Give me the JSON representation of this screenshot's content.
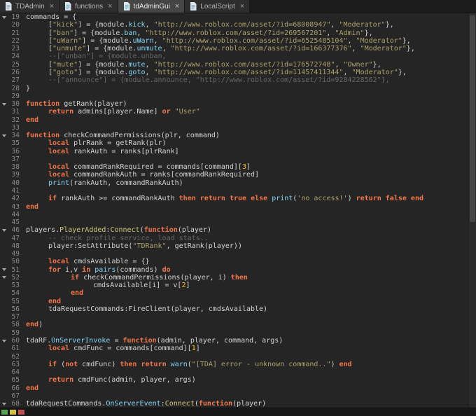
{
  "tabs": [
    {
      "label": "TDAdmin",
      "active": false,
      "icon_color": "#8AA9C4"
    },
    {
      "label": "functions",
      "active": false,
      "icon_color": "#56B8CF"
    },
    {
      "label": "tdAdminGui",
      "active": true,
      "icon_color": "#56B8CF"
    },
    {
      "label": "LocalScript",
      "active": false,
      "icon_color": "#6FA8DC"
    }
  ],
  "tab_close_glyph": "×",
  "colors": {
    "editor_bg": "#252525",
    "tabbar_bg": "#1b1b1b",
    "tab_bg": "#2d2d2d",
    "tab_active_bg": "#454545",
    "plain": "#D4D4D4",
    "keyword": "#F2764A",
    "string": "#ADA16D",
    "comment": "#676767",
    "number": "#FFC600",
    "builtin": "#84D6F7",
    "member": "#84D6F7",
    "method": "#CFC878",
    "line_number": "#8A8A8A"
  },
  "editor": {
    "language": "lua",
    "first_line": 19,
    "last_line": 68,
    "lines": [
      {
        "n": 19,
        "fold": true,
        "i": 0,
        "t": [
          [
            "p",
            "commands = {"
          ]
        ]
      },
      {
        "n": 20,
        "i": 1,
        "t": [
          [
            "p",
            "["
          ],
          [
            "s",
            "\"kick\""
          ],
          [
            "p",
            "] = {module."
          ],
          [
            "m",
            "kick"
          ],
          [
            "p",
            ", "
          ],
          [
            "s",
            "\"http://www.roblox.com/asset/?id=68008947\""
          ],
          [
            "p",
            ", "
          ],
          [
            "s",
            "\"Moderator\""
          ],
          [
            "p",
            "},"
          ]
        ]
      },
      {
        "n": 21,
        "i": 1,
        "t": [
          [
            "p",
            "["
          ],
          [
            "s",
            "\"ban\""
          ],
          [
            "p",
            "] = {module."
          ],
          [
            "m",
            "ban"
          ],
          [
            "p",
            ", "
          ],
          [
            "s",
            "\"http://www.roblox.com/asset/?id=269567201\""
          ],
          [
            "p",
            ", "
          ],
          [
            "s",
            "\"Admin\""
          ],
          [
            "p",
            "},"
          ]
        ]
      },
      {
        "n": 22,
        "i": 1,
        "t": [
          [
            "p",
            "["
          ],
          [
            "s",
            "\"uWarn\""
          ],
          [
            "p",
            "] = {module."
          ],
          [
            "m",
            "uWarn"
          ],
          [
            "p",
            ", "
          ],
          [
            "s",
            "\"http://www.roblox.com/asset/?id=6525485104\""
          ],
          [
            "p",
            ", "
          ],
          [
            "s",
            "\"Moderator\""
          ],
          [
            "p",
            "},"
          ]
        ]
      },
      {
        "n": 23,
        "i": 1,
        "t": [
          [
            "p",
            "["
          ],
          [
            "s",
            "\"unmute\""
          ],
          [
            "p",
            "] = {module."
          ],
          [
            "m",
            "unmute"
          ],
          [
            "p",
            ", "
          ],
          [
            "s",
            "\"http://www.roblox.com/asset/?id=166377376\""
          ],
          [
            "p",
            ", "
          ],
          [
            "s",
            "\"Moderator\""
          ],
          [
            "p",
            "},"
          ]
        ]
      },
      {
        "n": 24,
        "i": 1,
        "t": [
          [
            "c",
            "--[\"unban\"] = {module.unban,"
          ]
        ]
      },
      {
        "n": 25,
        "i": 1,
        "t": [
          [
            "p",
            "["
          ],
          [
            "s",
            "\"mute\""
          ],
          [
            "p",
            "] = {module."
          ],
          [
            "m",
            "mute"
          ],
          [
            "p",
            ", "
          ],
          [
            "s",
            "\"http://www.roblox.com/asset/?id=176572748\""
          ],
          [
            "p",
            ", "
          ],
          [
            "s",
            "\"Owner\""
          ],
          [
            "p",
            "},"
          ]
        ]
      },
      {
        "n": 26,
        "i": 1,
        "t": [
          [
            "p",
            "["
          ],
          [
            "s",
            "\"goto\""
          ],
          [
            "p",
            "] = {module."
          ],
          [
            "m",
            "goto"
          ],
          [
            "p",
            ", "
          ],
          [
            "s",
            "\"http://www.roblox.com/asset/?id=11457411344\""
          ],
          [
            "p",
            ", "
          ],
          [
            "s",
            "\"Moderator\""
          ],
          [
            "p",
            "},"
          ]
        ]
      },
      {
        "n": 27,
        "i": 1,
        "t": [
          [
            "c",
            "--[\"announce\"] = {module.announce, \"http://www.roblox.com/asset/?id=9284228562\"},"
          ]
        ]
      },
      {
        "n": 28,
        "i": 0,
        "t": [
          [
            "p",
            "}"
          ]
        ]
      },
      {
        "n": 29,
        "i": 0,
        "t": []
      },
      {
        "n": 30,
        "fold": true,
        "i": 0,
        "t": [
          [
            "k",
            "function"
          ],
          [
            "p",
            " getRank(player)"
          ]
        ]
      },
      {
        "n": 31,
        "i": 1,
        "t": [
          [
            "k",
            "return"
          ],
          [
            "p",
            " admins[player.Name] "
          ],
          [
            "k",
            "or"
          ],
          [
            "p",
            " "
          ],
          [
            "s",
            "\"User\""
          ]
        ]
      },
      {
        "n": 32,
        "i": 0,
        "t": [
          [
            "k",
            "end"
          ]
        ]
      },
      {
        "n": 33,
        "i": 0,
        "t": []
      },
      {
        "n": 34,
        "fold": true,
        "i": 0,
        "t": [
          [
            "k",
            "function"
          ],
          [
            "p",
            " checkCommandPermissions(plr, command)"
          ]
        ]
      },
      {
        "n": 35,
        "i": 1,
        "t": [
          [
            "k",
            "local"
          ],
          [
            "p",
            " plrRank = getRank(plr)"
          ]
        ]
      },
      {
        "n": 36,
        "i": 1,
        "t": [
          [
            "k",
            "local"
          ],
          [
            "p",
            " rankAuth = ranks[plrRank]"
          ]
        ]
      },
      {
        "n": 37,
        "i": 0,
        "t": []
      },
      {
        "n": 38,
        "i": 1,
        "t": [
          [
            "k",
            "local"
          ],
          [
            "p",
            " commandRankRequired = commands[command]["
          ],
          [
            "n",
            "3"
          ],
          [
            "p",
            "]"
          ]
        ]
      },
      {
        "n": 39,
        "i": 1,
        "t": [
          [
            "k",
            "local"
          ],
          [
            "p",
            " commandRankAuth = ranks[commandRankRequired]"
          ]
        ]
      },
      {
        "n": 40,
        "i": 1,
        "t": [
          [
            "b",
            "print"
          ],
          [
            "p",
            "(rankAuth, commandRankAuth)"
          ]
        ]
      },
      {
        "n": 41,
        "i": 0,
        "t": []
      },
      {
        "n": 42,
        "i": 1,
        "t": [
          [
            "k",
            "if"
          ],
          [
            "p",
            " rankAuth >= commandRankAuth "
          ],
          [
            "k",
            "then"
          ],
          [
            "p",
            " "
          ],
          [
            "k",
            "return"
          ],
          [
            "p",
            " "
          ],
          [
            "k",
            "true"
          ],
          [
            "p",
            " "
          ],
          [
            "k",
            "else"
          ],
          [
            "p",
            " "
          ],
          [
            "b",
            "print"
          ],
          [
            "p",
            "("
          ],
          [
            "s",
            "'no access!'"
          ],
          [
            "p",
            ") "
          ],
          [
            "k",
            "return"
          ],
          [
            "p",
            " "
          ],
          [
            "k",
            "false"
          ],
          [
            "p",
            " "
          ],
          [
            "k",
            "end"
          ]
        ]
      },
      {
        "n": 43,
        "i": 0,
        "t": [
          [
            "k",
            "end"
          ]
        ]
      },
      {
        "n": 44,
        "i": 0,
        "t": []
      },
      {
        "n": 45,
        "i": 0,
        "t": []
      },
      {
        "n": 46,
        "fold": true,
        "i": 0,
        "t": [
          [
            "p",
            "players."
          ],
          [
            "f",
            "PlayerAdded"
          ],
          [
            "p",
            ":"
          ],
          [
            "f",
            "Connect"
          ],
          [
            "p",
            "("
          ],
          [
            "k",
            "function"
          ],
          [
            "p",
            "(player)"
          ]
        ]
      },
      {
        "n": 47,
        "i": 1,
        "t": [
          [
            "c",
            "-- check profile service, load stats.."
          ]
        ]
      },
      {
        "n": 48,
        "i": 1,
        "t": [
          [
            "p",
            "player:SetAttribute("
          ],
          [
            "s",
            "\"TDRank\""
          ],
          [
            "p",
            ", getRank(player))"
          ]
        ]
      },
      {
        "n": 49,
        "i": 0,
        "t": []
      },
      {
        "n": 50,
        "i": 1,
        "t": [
          [
            "k",
            "local"
          ],
          [
            "p",
            " cmdsAvailable = {}"
          ]
        ]
      },
      {
        "n": 51,
        "fold": true,
        "i": 1,
        "t": [
          [
            "k",
            "for"
          ],
          [
            "p",
            " i,v "
          ],
          [
            "k",
            "in"
          ],
          [
            "p",
            " "
          ],
          [
            "b",
            "pairs"
          ],
          [
            "p",
            "(commands) "
          ],
          [
            "k",
            "do"
          ]
        ]
      },
      {
        "n": 52,
        "fold": true,
        "i": 2,
        "t": [
          [
            "k",
            "if"
          ],
          [
            "p",
            " checkCommandPermissions(player, i) "
          ],
          [
            "k",
            "then"
          ]
        ]
      },
      {
        "n": 53,
        "i": 3,
        "t": [
          [
            "p",
            "cmdsAvailable[i] = v["
          ],
          [
            "n",
            "2"
          ],
          [
            "p",
            "]"
          ]
        ]
      },
      {
        "n": 54,
        "i": 2,
        "t": [
          [
            "k",
            "end"
          ]
        ]
      },
      {
        "n": 55,
        "i": 1,
        "t": [
          [
            "k",
            "end"
          ]
        ]
      },
      {
        "n": 56,
        "i": 1,
        "t": [
          [
            "p",
            "tdaRequestCommands:FireClient(player, cmdsAvailable)"
          ]
        ]
      },
      {
        "n": 57,
        "i": 0,
        "t": []
      },
      {
        "n": 58,
        "i": 0,
        "t": [
          [
            "k",
            "end"
          ],
          [
            "p",
            ")"
          ]
        ]
      },
      {
        "n": 59,
        "i": 0,
        "t": []
      },
      {
        "n": 60,
        "fold": true,
        "i": 0,
        "t": [
          [
            "p",
            "tdaRF."
          ],
          [
            "m",
            "OnServerInvoke"
          ],
          [
            "p",
            " = "
          ],
          [
            "k",
            "function"
          ],
          [
            "p",
            "(admin, player, command, args)"
          ]
        ]
      },
      {
        "n": 61,
        "i": 1,
        "t": [
          [
            "k",
            "local"
          ],
          [
            "p",
            " cmdFunc = commands[command]["
          ],
          [
            "n",
            "1"
          ],
          [
            "p",
            "]"
          ]
        ]
      },
      {
        "n": 62,
        "i": 0,
        "t": []
      },
      {
        "n": 63,
        "i": 1,
        "t": [
          [
            "k",
            "if"
          ],
          [
            "p",
            " ("
          ],
          [
            "k",
            "not"
          ],
          [
            "p",
            " cmdFunc) "
          ],
          [
            "k",
            "then"
          ],
          [
            "p",
            " "
          ],
          [
            "k",
            "return"
          ],
          [
            "p",
            " "
          ],
          [
            "b",
            "warn"
          ],
          [
            "p",
            "("
          ],
          [
            "s",
            "\"[TDA] error - unknown command..\""
          ],
          [
            "p",
            ") "
          ],
          [
            "k",
            "end"
          ]
        ]
      },
      {
        "n": 64,
        "i": 0,
        "t": []
      },
      {
        "n": 65,
        "i": 1,
        "t": [
          [
            "k",
            "return"
          ],
          [
            "p",
            " cmdFunc(admin, player, args)"
          ]
        ]
      },
      {
        "n": 66,
        "i": 0,
        "t": [
          [
            "k",
            "end"
          ]
        ]
      },
      {
        "n": 67,
        "i": 0,
        "t": []
      },
      {
        "n": 68,
        "fold": true,
        "i": 0,
        "t": [
          [
            "p",
            "tdaRequestCommands."
          ],
          [
            "m",
            "OnServerEvent"
          ],
          [
            "p",
            ":"
          ],
          [
            "f",
            "Connect"
          ],
          [
            "p",
            "("
          ],
          [
            "k",
            "function"
          ],
          [
            "p",
            "(player)"
          ]
        ]
      }
    ]
  },
  "bottom": {
    "chips": [
      "#56A456",
      "#D5C04A",
      "#C15151"
    ]
  }
}
